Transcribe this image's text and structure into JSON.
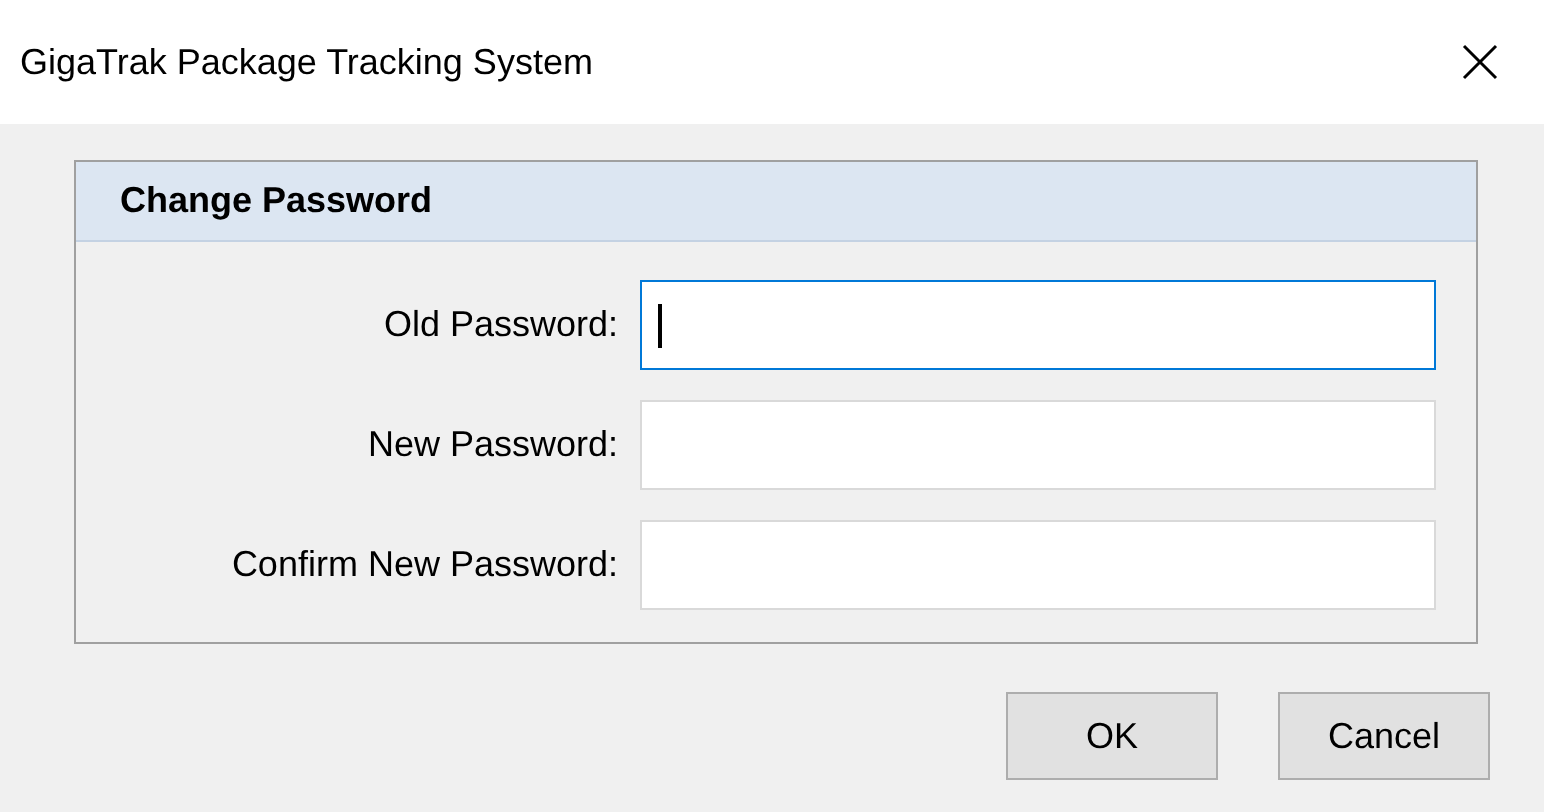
{
  "window": {
    "title": "GigaTrak Package Tracking System"
  },
  "panel": {
    "title": "Change Password",
    "fields": [
      {
        "label": "Old Password:",
        "focused": true
      },
      {
        "label": "New Password:",
        "focused": false
      },
      {
        "label": "Confirm New Password:",
        "focused": false
      }
    ]
  },
  "buttons": [
    "OK",
    "Cancel"
  ]
}
